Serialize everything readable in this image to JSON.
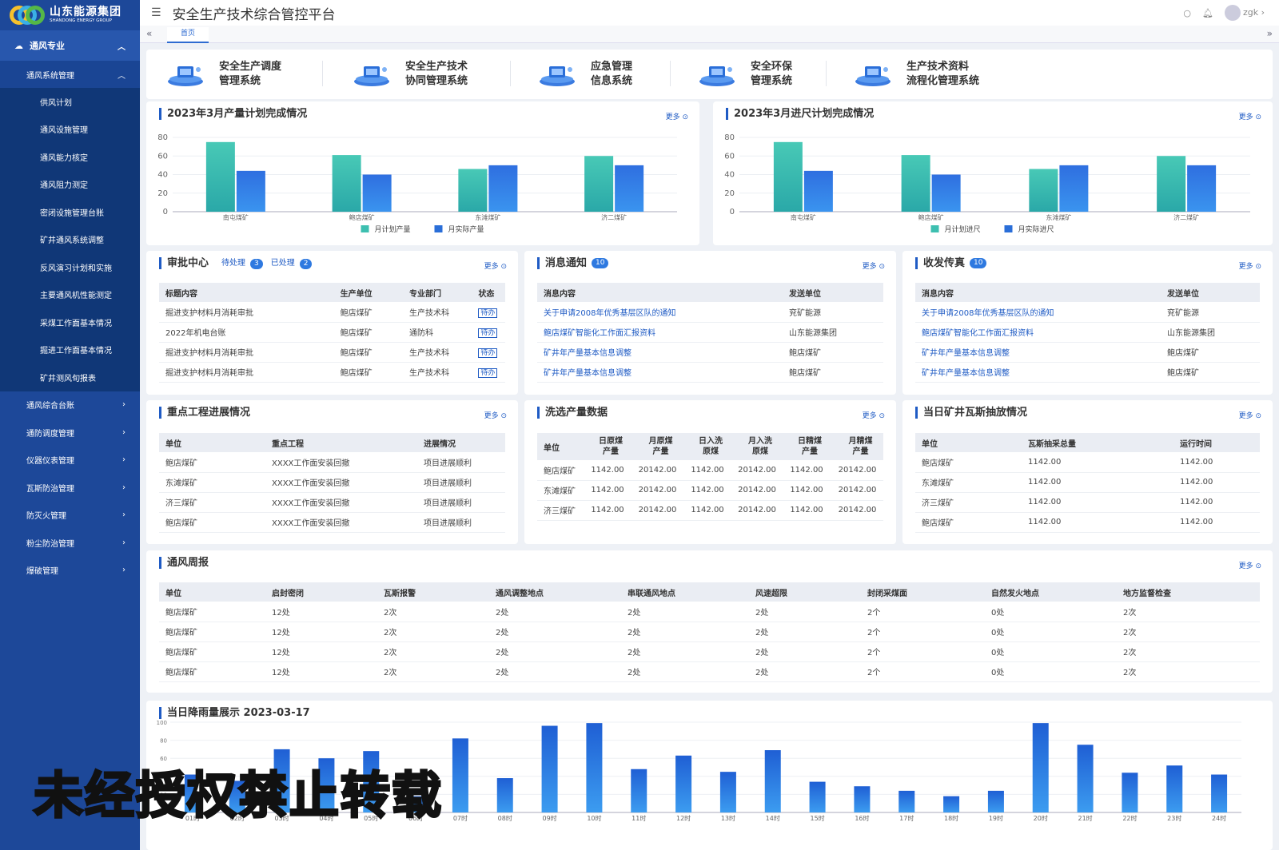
{
  "brand": {
    "name": "山东能源集团",
    "en": "SHANDONG ENERGY GROUP"
  },
  "sidebar": {
    "top": "通风专业",
    "sub_open": "通风系统管理",
    "leaves": [
      "供风计划",
      "通风设施管理",
      "通风能力核定",
      "通风阻力测定",
      "密闭设施管理台账",
      "矿井通风系统调整",
      "反风演习计划和实施",
      "主要通风机性能测定",
      "采煤工作面基本情况",
      "掘进工作面基本情况",
      "矿井测风旬报表"
    ],
    "groups": [
      "通风综合台账",
      "通防调度管理",
      "仪器仪表管理",
      "瓦斯防治管理",
      "防灭火管理",
      "粉尘防治管理",
      "爆破管理"
    ]
  },
  "header": {
    "title": "安全生产技术综合管控平台",
    "user": "zgk"
  },
  "tabs": {
    "home": "首页"
  },
  "systems": [
    {
      "l1": "安全生产调度",
      "l2": "管理系统"
    },
    {
      "l1": "安全生产技术",
      "l2": "协同管理系统"
    },
    {
      "l1": "应急管理",
      "l2": "信息系统"
    },
    {
      "l1": "安全环保",
      "l2": "管理系统"
    },
    {
      "l1": "生产技术资料",
      "l2": "流程化管理系统"
    }
  ],
  "more": "更多",
  "chart1": {
    "title": "2023年3月产量计划完成情况"
  },
  "chart2": {
    "title": "2023年3月进尺计划完成情况"
  },
  "chart3": {
    "title": "当日降雨量展示 2023-03-17"
  },
  "chart_data": [
    {
      "type": "bar",
      "title": "2023年3月产量计划完成情况",
      "categories": [
        "南屯煤矿",
        "鲍店煤矿",
        "东滩煤矿",
        "济二煤矿"
      ],
      "series": [
        {
          "name": "月计划产量",
          "values": [
            75,
            61,
            46,
            60
          ]
        },
        {
          "name": "月实际产量",
          "values": [
            44,
            40,
            50,
            50
          ]
        }
      ],
      "ylim": [
        0,
        80
      ],
      "yticks": [
        0,
        20,
        40,
        60,
        80
      ],
      "colors": [
        "#3dbfb0",
        "#2a6ed8"
      ],
      "legend": "bottom"
    },
    {
      "type": "bar",
      "title": "2023年3月进尺计划完成情况",
      "categories": [
        "南屯煤矿",
        "鲍店煤矿",
        "东滩煤矿",
        "济二煤矿"
      ],
      "series": [
        {
          "name": "月计划进尺",
          "values": [
            75,
            61,
            46,
            60
          ]
        },
        {
          "name": "月实际进尺",
          "values": [
            44,
            40,
            50,
            50
          ]
        }
      ],
      "ylim": [
        0,
        80
      ],
      "yticks": [
        0,
        20,
        40,
        60,
        80
      ],
      "colors": [
        "#3dbfb0",
        "#2a6ed8"
      ],
      "legend": "bottom"
    },
    {
      "type": "bar",
      "title": "当日降雨量展示 2023-03-17",
      "categories": [
        "01时",
        "02时",
        "03时",
        "04时",
        "05时",
        "06时",
        "07时",
        "08时",
        "09时",
        "10时",
        "11时",
        "12时",
        "13时",
        "14时",
        "15时",
        "16时",
        "17时",
        "18时",
        "19时",
        "20时",
        "21时",
        "22时",
        "23时",
        "24时"
      ],
      "values": [
        42,
        35,
        70,
        60,
        68,
        18,
        82,
        38,
        96,
        99,
        48,
        63,
        45,
        69,
        34,
        29,
        24,
        18,
        24,
        99,
        75,
        44,
        52,
        42
      ],
      "ylim": [
        0,
        100
      ],
      "yticks": [
        0,
        20,
        40,
        60,
        80,
        100
      ],
      "colors": [
        "#2a6ed8"
      ]
    }
  ],
  "approval": {
    "title": "审批中心",
    "pending_label": "待处理",
    "pending_count": "3",
    "done_label": "已处理",
    "done_count": "2",
    "headers": [
      "标题内容",
      "生产单位",
      "专业部门",
      "状态"
    ],
    "rows": [
      [
        "掘进支护材料月消耗审批",
        "鲍店煤矿",
        "生产技术科",
        "待办"
      ],
      [
        "2022年机电台账",
        "鲍店煤矿",
        "通防科",
        "待办"
      ],
      [
        "掘进支护材料月消耗审批",
        "鲍店煤矿",
        "生产技术科",
        "待办"
      ],
      [
        "掘进支护材料月消耗审批",
        "鲍店煤矿",
        "生产技术科",
        "待办"
      ]
    ]
  },
  "notice": {
    "title": "消息通知",
    "count": "10",
    "headers": [
      "消息内容",
      "发送单位"
    ],
    "rows": [
      [
        "关于申请2008年优秀基层区队的通知",
        "兖矿能源"
      ],
      [
        "鲍店煤矿智能化工作面汇报资料",
        "山东能源集团"
      ],
      [
        "矿井年产量基本信息调整",
        "鲍店煤矿"
      ],
      [
        "矿井年产量基本信息调整",
        "鲍店煤矿"
      ]
    ]
  },
  "fax": {
    "title": "收发传真",
    "count": "10",
    "headers": [
      "消息内容",
      "发送单位"
    ],
    "rows": [
      [
        "关于申请2008年优秀基层区队的通知",
        "兖矿能源"
      ],
      [
        "鲍店煤矿智能化工作面汇报资料",
        "山东能源集团"
      ],
      [
        "矿井年产量基本信息调整",
        "鲍店煤矿"
      ],
      [
        "矿井年产量基本信息调整",
        "鲍店煤矿"
      ]
    ]
  },
  "projects": {
    "title": "重点工程进展情况",
    "headers": [
      "单位",
      "重点工程",
      "进展情况"
    ],
    "rows": [
      [
        "鲍店煤矿",
        "XXXX工作面安装回撤",
        "项目进展顺利"
      ],
      [
        "东滩煤矿",
        "XXXX工作面安装回撤",
        "项目进展顺利"
      ],
      [
        "济三煤矿",
        "XXXX工作面安装回撤",
        "项目进展顺利"
      ],
      [
        "鲍店煤矿",
        "XXXX工作面安装回撤",
        "项目进展顺利"
      ]
    ]
  },
  "washing": {
    "title": "洗选产量数据",
    "headers": [
      "单位",
      "日原煤\n产量",
      "月原煤\n产量",
      "日入洗\n原煤",
      "月入洗\n原煤",
      "日精煤\n产量",
      "月精煤\n产量"
    ],
    "rows": [
      [
        "鲍店煤矿",
        "1142.00",
        "20142.00",
        "1142.00",
        "20142.00",
        "1142.00",
        "20142.00"
      ],
      [
        "东滩煤矿",
        "1142.00",
        "20142.00",
        "1142.00",
        "20142.00",
        "1142.00",
        "20142.00"
      ],
      [
        "济三煤矿",
        "1142.00",
        "20142.00",
        "1142.00",
        "20142.00",
        "1142.00",
        "20142.00"
      ]
    ]
  },
  "gas": {
    "title": "当日矿井瓦斯抽放情况",
    "headers": [
      "单位",
      "瓦斯抽采总量",
      "运行时间"
    ],
    "rows": [
      [
        "鲍店煤矿",
        "1142.00",
        "1142.00"
      ],
      [
        "东滩煤矿",
        "1142.00",
        "1142.00"
      ],
      [
        "济三煤矿",
        "1142.00",
        "1142.00"
      ],
      [
        "鲍店煤矿",
        "1142.00",
        "1142.00"
      ]
    ]
  },
  "weekly": {
    "title": "通风周报",
    "headers": [
      "单位",
      "启封密闭",
      "瓦斯报警",
      "通风调整地点",
      "串联通风地点",
      "风速超限",
      "封闭采煤面",
      "自然发火地点",
      "地方监督检查"
    ],
    "rows": [
      [
        "鲍店煤矿",
        "12处",
        "2次",
        "2处",
        "2处",
        "2处",
        "2个",
        "0处",
        "2次"
      ],
      [
        "鲍店煤矿",
        "12处",
        "2次",
        "2处",
        "2处",
        "2处",
        "2个",
        "0处",
        "2次"
      ],
      [
        "鲍店煤矿",
        "12处",
        "2次",
        "2处",
        "2处",
        "2处",
        "2个",
        "0处",
        "2次"
      ],
      [
        "鲍店煤矿",
        "12处",
        "2次",
        "2处",
        "2处",
        "2处",
        "2个",
        "0处",
        "2次"
      ]
    ]
  },
  "watermark": "未经授权禁止转载"
}
